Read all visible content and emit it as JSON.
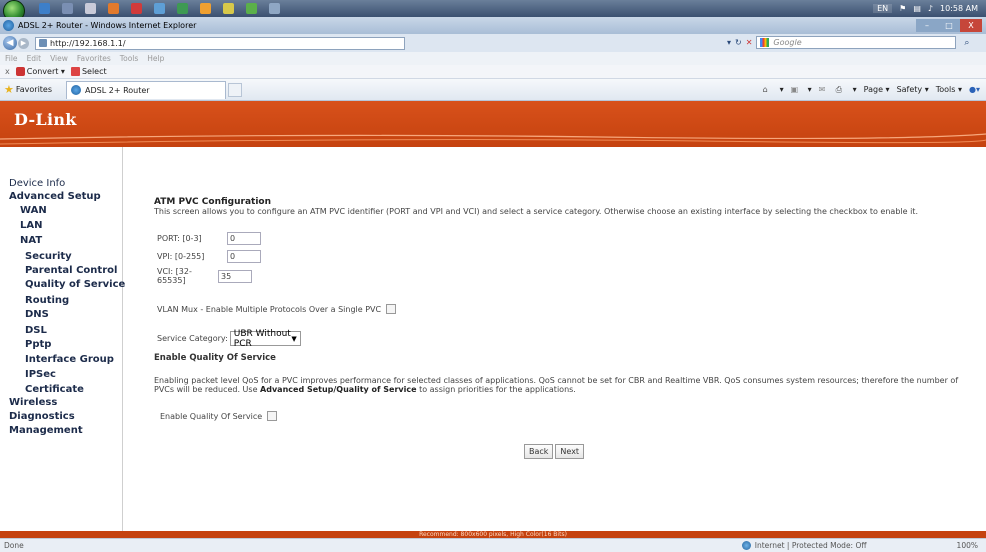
{
  "taskbar": {
    "lang": "EN",
    "clock": "10:58 AM"
  },
  "window": {
    "title": "ADSL 2+ Router - Windows Internet Explorer",
    "min": "–",
    "max": "□",
    "close": "X"
  },
  "address_bar": {
    "url": "http://192.168.1.1/",
    "search_placeholder": "Google"
  },
  "menu": [
    "File",
    "Edit",
    "View",
    "Favorites",
    "Tools",
    "Help"
  ],
  "toolbar2": {
    "close": "x",
    "convert": "Convert",
    "select": "Select"
  },
  "favbar": {
    "favorites": "Favorites",
    "tab_title": "ADSL 2+ Router",
    "page": "Page",
    "safety": "Safety",
    "tools": "Tools"
  },
  "brand": {
    "logo": "D-Link"
  },
  "sidebar": {
    "items": [
      {
        "label": "Device Info"
      },
      {
        "label": "Advanced Setup"
      },
      {
        "label": "WAN"
      },
      {
        "label": "LAN"
      },
      {
        "label": "NAT"
      },
      {
        "label": "Security"
      },
      {
        "label": "Parental Control"
      },
      {
        "label": "Quality of Service"
      },
      {
        "label": "Routing"
      },
      {
        "label": "DNS"
      },
      {
        "label": "DSL"
      },
      {
        "label": "Pptp"
      },
      {
        "label": "Interface Group"
      },
      {
        "label": "IPSec"
      },
      {
        "label": "Certificate"
      },
      {
        "label": "Wireless"
      },
      {
        "label": "Diagnostics"
      },
      {
        "label": "Management"
      }
    ]
  },
  "main": {
    "title": "ATM PVC Configuration",
    "description": "This screen allows you to configure an ATM PVC identifier (PORT and VPI and VCI) and select a service category. Otherwise choose an existing interface by selecting the checkbox to enable it.",
    "port_label": "PORT: [0-3]",
    "port_value": "0",
    "vpi_label": "VPI: [0-255]",
    "vpi_value": "0",
    "vci_label": "VCI: [32-65535]",
    "vci_value": "35",
    "vlan_label": "VLAN Mux - Enable Multiple Protocols Over a Single PVC",
    "service_label": "Service Category:",
    "service_value": "UBR Without PCR",
    "qos_heading": "Enable Quality Of Service",
    "qos_desc_1": "Enabling packet level QoS for a PVC improves performance for selected classes of applications.  QoS cannot be set for CBR and Realtime VBR.  QoS consumes system resources; therefore the number of PVCs will be reduced. Use ",
    "qos_desc_bold": "Advanced Setup/Quality of Service",
    "qos_desc_2": " to assign priorities for the applications.",
    "qos_check_label": "Enable Quality Of Service",
    "back_label": "Back",
    "next_label": "Next"
  },
  "footer": {
    "recommend": "Recommend: 800x600 pixels, High Color(16 Bits)"
  },
  "statusbar": {
    "left": "Done",
    "zone": "Internet | Protected Mode: Off",
    "zoom": "100%"
  },
  "colors": {
    "brand_orange": "#c5420f",
    "nav_text": "#1c2b4a"
  }
}
